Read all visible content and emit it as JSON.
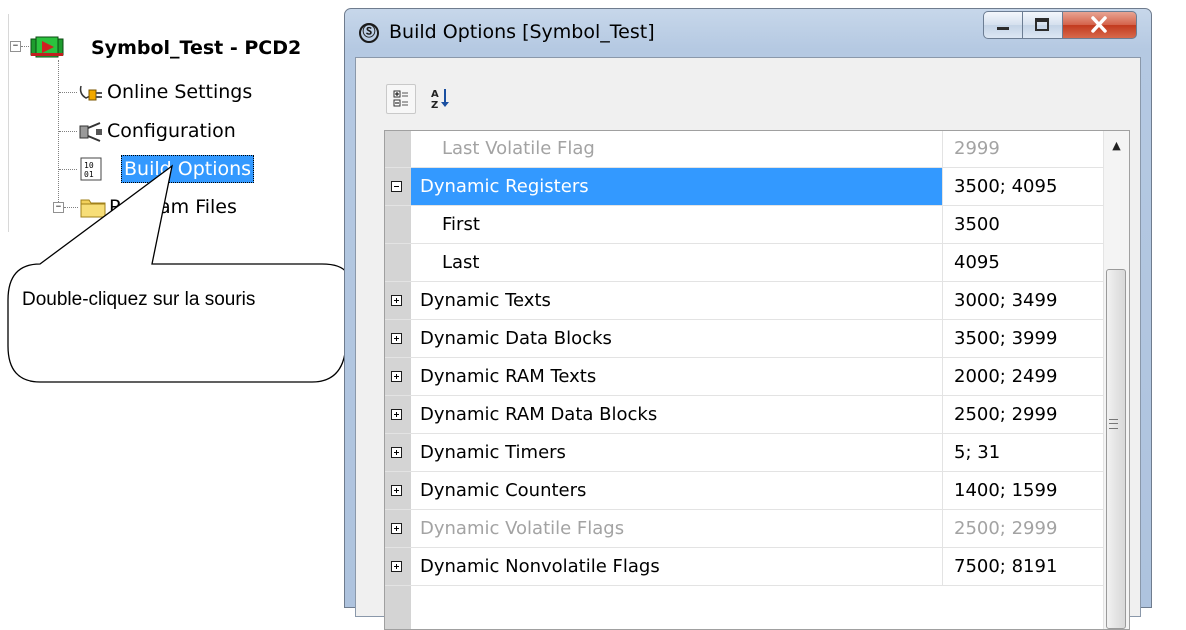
{
  "tree": {
    "root": {
      "label": "Symbol_Test - PCD2",
      "expander": "−"
    },
    "items": [
      {
        "label": "Online Settings",
        "icon": "plug-icon"
      },
      {
        "label": "Configuration",
        "icon": "configuration-icon"
      },
      {
        "label": "Build Options",
        "icon": "build-options-icon"
      },
      {
        "label": "Program Files",
        "icon": "folder-icon",
        "expander": "−"
      }
    ]
  },
  "callout": {
    "text": "Double-cliquez sur la souris"
  },
  "window": {
    "title": "Build Options [Symbol_Test]",
    "title_icon": "Ⓢ",
    "buttons": {
      "minimize": "—",
      "maximize": "☐",
      "close": "X"
    },
    "toolbar": {
      "categorized": "categorized-view-icon",
      "alphabetical": "sort-az-icon"
    },
    "properties": [
      {
        "name": "Last Volatile Flag",
        "value": "2999",
        "kind": "child",
        "disabled": true
      },
      {
        "name": "Dynamic Registers",
        "value": "3500; 4095",
        "kind": "group",
        "expanded": true,
        "selected": true
      },
      {
        "name": "First",
        "value": "3500",
        "kind": "child"
      },
      {
        "name": "Last",
        "value": "4095",
        "kind": "child"
      },
      {
        "name": "Dynamic Texts",
        "value": "3000; 3499",
        "kind": "group"
      },
      {
        "name": "Dynamic Data Blocks",
        "value": "3500; 3999",
        "kind": "group"
      },
      {
        "name": "Dynamic RAM Texts",
        "value": "2000; 2499",
        "kind": "group"
      },
      {
        "name": "Dynamic RAM Data Blocks",
        "value": "2500; 2999",
        "kind": "group"
      },
      {
        "name": "Dynamic Timers",
        "value": "5; 31",
        "kind": "group"
      },
      {
        "name": "Dynamic Counters",
        "value": "1400; 1599",
        "kind": "group"
      },
      {
        "name": "Dynamic Volatile Flags",
        "value": "2500; 2999",
        "kind": "group",
        "disabled": true
      },
      {
        "name": "Dynamic Nonvolatile Flags",
        "value": "7500; 8191",
        "kind": "group"
      }
    ],
    "scrollbar": {
      "up_arrow": "▲"
    }
  },
  "colors": {
    "selection": "#3399ff",
    "disabled_text": "#a3a3a3",
    "close_button": "#c23a1e"
  }
}
